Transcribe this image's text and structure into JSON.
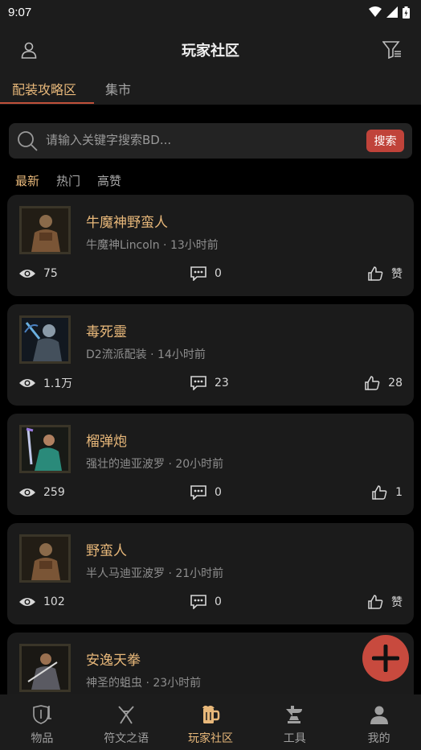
{
  "status_bar": {
    "time": "9:07"
  },
  "header": {
    "title": "玩家社区"
  },
  "tabs": [
    {
      "label": "配装攻略区",
      "active": true
    },
    {
      "label": "集市",
      "active": false
    }
  ],
  "search": {
    "placeholder": "请输入关键字搜索BD...",
    "button_label": "搜索"
  },
  "sort_tabs": [
    {
      "label": "最新",
      "active": true
    },
    {
      "label": "热门",
      "active": false
    },
    {
      "label": "高赞",
      "active": false
    }
  ],
  "posts": [
    {
      "title": "牛魔神野蛮人",
      "subtitle": "牛魔神Lincoln · 13小时前",
      "views": "75",
      "comments": "0",
      "likes": "赞",
      "avatar": "barbarian-portrait"
    },
    {
      "title": "毒死靈",
      "subtitle": "D2流派配装 · 14小时前",
      "views": "1.1万",
      "comments": "23",
      "likes": "28",
      "avatar": "necromancer-portrait"
    },
    {
      "title": "榴弹炮",
      "subtitle": "强壮的迪亚波罗 · 20小时前",
      "views": "259",
      "comments": "0",
      "likes": "1",
      "avatar": "amazon-portrait"
    },
    {
      "title": "野蛮人",
      "subtitle": "半人马迪亚波罗 · 21小时前",
      "views": "102",
      "comments": "0",
      "likes": "赞",
      "avatar": "barbarian-portrait"
    },
    {
      "title": "安逸天拳",
      "subtitle": "神圣的蛆虫 · 23小时前",
      "views": "",
      "comments": "",
      "likes": "",
      "avatar": "paladin-portrait"
    }
  ],
  "bottom_nav": [
    {
      "label": "物品",
      "icon": "shield-sword-icon",
      "active": false
    },
    {
      "label": "符文之语",
      "icon": "rune-icon",
      "active": false
    },
    {
      "label": "玩家社区",
      "icon": "beer-mug-icon",
      "active": true
    },
    {
      "label": "工具",
      "icon": "anvil-icon",
      "active": false
    },
    {
      "label": "我的",
      "icon": "person-icon",
      "active": false
    }
  ],
  "colors": {
    "accent": "#e8b87a",
    "brand_red": "#c84a3e",
    "background": "#000000",
    "card": "#1b1b1b"
  }
}
